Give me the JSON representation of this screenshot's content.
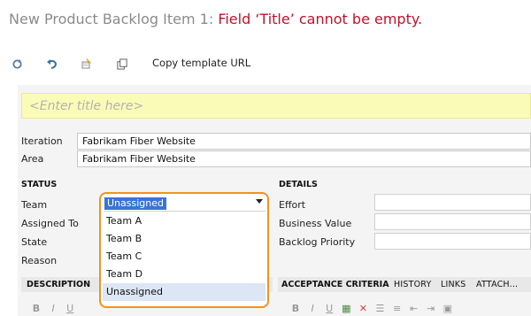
{
  "header": {
    "title_prefix": "New Product Backlog Item 1: ",
    "title_error": "Field ‘Title’ cannot be empty."
  },
  "toolbar": {
    "icons": [
      "refresh-icon",
      "undo-icon",
      "clear-formatting-icon",
      "copy-icon"
    ],
    "copy_template_url": "Copy template URL"
  },
  "title_field": {
    "placeholder": "<Enter title here>"
  },
  "planning": {
    "iteration_label": "Iteration",
    "iteration_value": "Fabrikam Fiber Website",
    "area_label": "Area",
    "area_value": "Fabrikam Fiber Website"
  },
  "status": {
    "header": "STATUS",
    "team_label": "Team",
    "assigned_to_label": "Assigned To",
    "state_label": "State",
    "reason_label": "Reason",
    "team_selected": "Unassigned",
    "team_options": [
      "Team A",
      "Team B",
      "Team C",
      "Team D",
      "Unassigned"
    ],
    "highlighted_option": "Unassigned"
  },
  "details": {
    "header": "DETAILS",
    "effort_label": "Effort",
    "business_value_label": "Business Value",
    "backlog_priority_label": "Backlog Priority"
  },
  "tabs": {
    "description": "DESCRIPTION",
    "acceptance_criteria": "ACCEPTANCE CRITERIA",
    "history": "HISTORY",
    "links": "LINKS",
    "attachments": "ATTACH..."
  },
  "editor": {
    "bold": "B",
    "italic": "I",
    "underline": "U"
  },
  "colors": {
    "error_red": "#c0122a",
    "title_bg": "#fbfbb8",
    "highlight_orange": "#f0931e",
    "selection_blue": "#3875d7"
  }
}
